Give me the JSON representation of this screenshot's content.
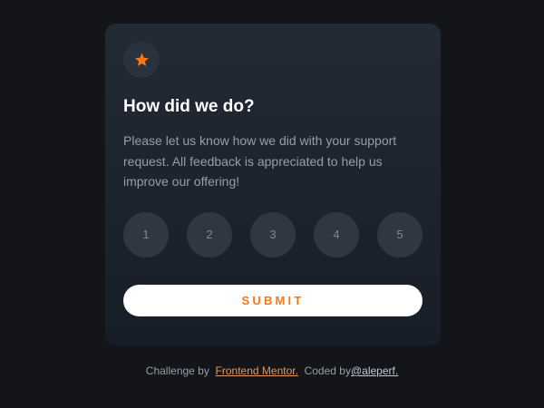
{
  "card": {
    "icon": "star-icon",
    "title": "How did we do?",
    "description": "Please let us know how we did with your support request. All feedback is appreciated to help us improve our offering!",
    "ratings": [
      "1",
      "2",
      "3",
      "4",
      "5"
    ],
    "submit_label": "SUBMIT"
  },
  "footer": {
    "challenge_prefix": "Challenge by ",
    "frontend_mentor": "Frontend Mentor.",
    "coded_by": "Coded by",
    "author": "@aleperf."
  },
  "colors": {
    "accent": "#fc7614",
    "background": "#131518",
    "card": "#232a34",
    "rating_bg": "#2f3741",
    "text_muted": "#959eac"
  }
}
